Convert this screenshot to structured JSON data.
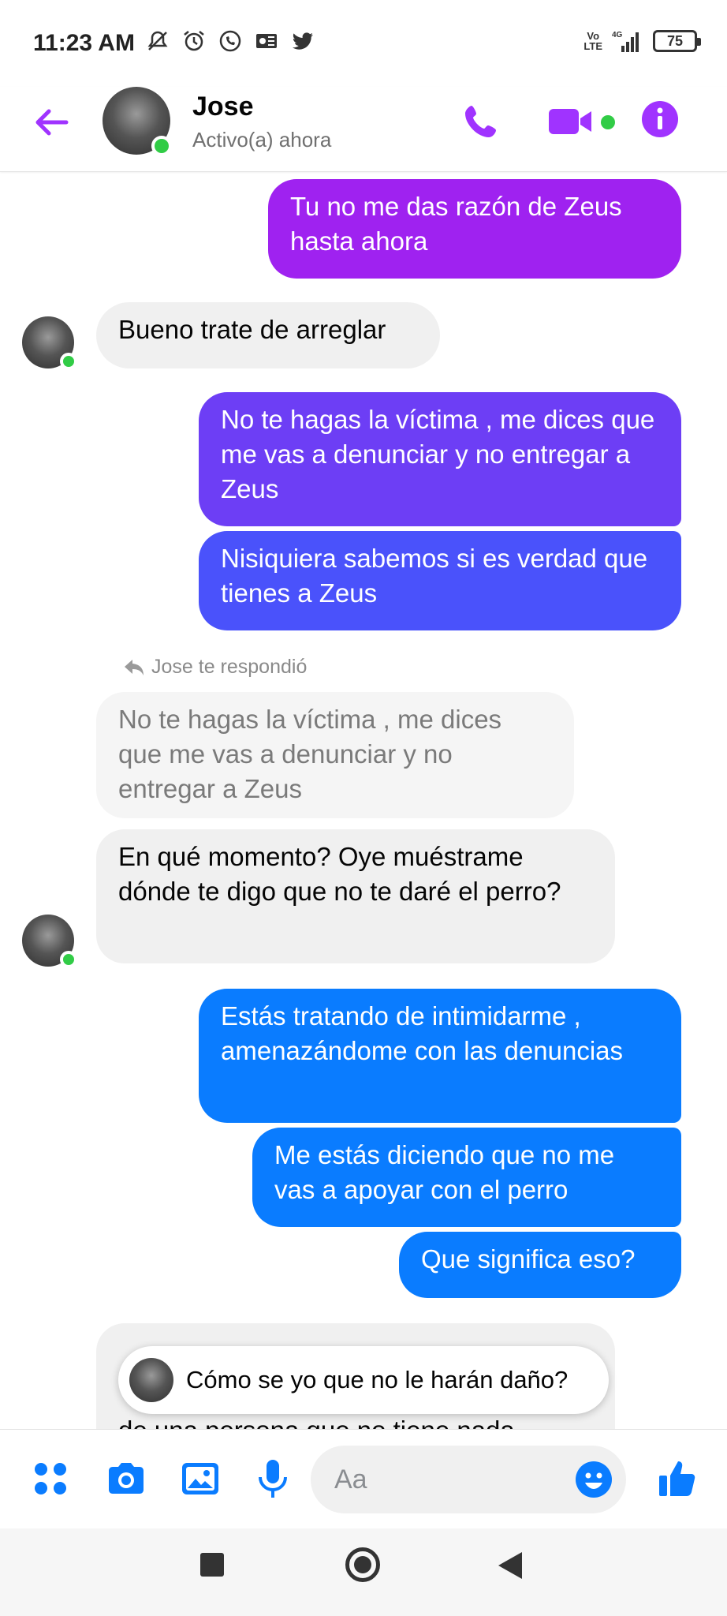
{
  "status_bar": {
    "time": "11:23 AM",
    "network_top": "Vo",
    "network_bottom": "LTE",
    "signal": "4G",
    "battery": "75",
    "icons": [
      "mute-icon",
      "alarm-icon",
      "whatsapp-icon",
      "outlook-icon",
      "twitter-icon"
    ]
  },
  "header": {
    "contact_name": "Jose",
    "contact_status": "Activo(a) ahora",
    "accent_color": "#a033ff"
  },
  "messages": [
    {
      "side": "out",
      "text": "Tu no me das razón de Zeus hasta ahora",
      "color": "#9f22f0"
    },
    {
      "side": "in",
      "text": "Bueno trate de arreglar"
    },
    {
      "side": "out",
      "text": "No te hagas la víctima , me dices que me vas a denunciar y no entregar a Zeus",
      "color": "#6d3ef5"
    },
    {
      "side": "out",
      "text": "Nisiquiera sabemos si es verdad que tienes a Zeus",
      "color": "#4a52fb"
    },
    {
      "side": "in",
      "text": "En qué momento? Oye muéstrame dónde te digo que no te daré el perro?"
    },
    {
      "side": "out",
      "text": "Estás tratando de intimidarme , amenazándome con las denuncias",
      "color": "#0a7cff"
    },
    {
      "side": "out",
      "text": "Me estás diciendo que no me vas a apoyar con el perro",
      "color": "#0a7cff"
    },
    {
      "side": "out",
      "text": "Que significa eso?",
      "color": "#0a7cff"
    },
    {
      "side": "in",
      "text": "de una persona que no tiene nada"
    }
  ],
  "reply_context": {
    "label": "Jose te respondió",
    "quoted_text": "No te hagas la víctima , me dices que me vas a denunciar y no entregar a Zeus"
  },
  "typing_toast": {
    "text": "Cómo se yo que no le harán daño?"
  },
  "composer": {
    "placeholder": "Aa",
    "accent_color": "#0a7cff"
  }
}
